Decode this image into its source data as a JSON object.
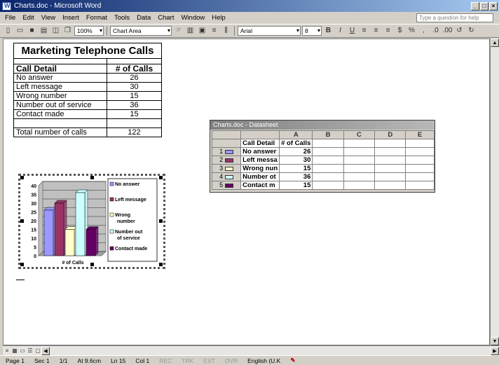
{
  "window": {
    "title": "Charts.doc - Microsoft Word"
  },
  "menu": [
    "File",
    "Edit",
    "View",
    "Insert",
    "Format",
    "Tools",
    "Data",
    "Chart",
    "Window",
    "Help"
  ],
  "help_placeholder": "Type a question for help",
  "toolbar": {
    "zoom": "100%",
    "chart_object": "Chart Area",
    "font": "Arial",
    "size": "8"
  },
  "word_table": {
    "title": "Marketing Telephone Calls",
    "col_headers": [
      "Call Detail",
      "# of Calls"
    ],
    "rows": [
      [
        "No answer",
        "26"
      ],
      [
        "Left message",
        "30"
      ],
      [
        "Wrong number",
        "15"
      ],
      [
        "Number out of service",
        "36"
      ],
      [
        "Contact made",
        "15"
      ]
    ],
    "total_label": "Total number of calls",
    "total_value": "122"
  },
  "chart_data": {
    "type": "bar",
    "categories": [
      "# of Calls"
    ],
    "series": [
      {
        "name": "No answer",
        "values": [
          26
        ],
        "color": "#9999ff"
      },
      {
        "name": "Left message",
        "values": [
          30
        ],
        "color": "#993366"
      },
      {
        "name": "Wrong number",
        "values": [
          15
        ],
        "color": "#ffffcc"
      },
      {
        "name": "Number out of service",
        "values": [
          36
        ],
        "color": "#ccffff"
      },
      {
        "name": "Contact made",
        "values": [
          15
        ],
        "color": "#660066"
      }
    ],
    "legend_labels": [
      "No answer",
      "Left message",
      "Wrong",
      "number",
      "Number out",
      "of service",
      "Contact made"
    ],
    "yticks": [
      "0",
      "5",
      "10",
      "15",
      "20",
      "25",
      "30",
      "35",
      "40"
    ],
    "ylim": [
      0,
      40
    ],
    "xlabel": "# of Calls",
    "legend": "right",
    "grid": true
  },
  "datasheet": {
    "title": "Charts.doc - Datasheet",
    "columns": [
      "A",
      "B",
      "C",
      "D",
      "E"
    ],
    "header_row": [
      "Call Detail",
      "# of Calls"
    ],
    "rows": [
      {
        "num": "1",
        "label": "No answer",
        "value": "26",
        "color": "#9999ff"
      },
      {
        "num": "2",
        "label": "Left messa",
        "value": "30",
        "color": "#993366"
      },
      {
        "num": "3",
        "label": "Wrong nun",
        "value": "15",
        "color": "#ffffcc"
      },
      {
        "num": "4",
        "label": "Number ot",
        "value": "36",
        "color": "#ccffff"
      },
      {
        "num": "5",
        "label": "Contact m",
        "value": "15",
        "color": "#660066"
      }
    ]
  },
  "status": {
    "page": "Page 1",
    "sec": "Sec 1",
    "pages": "1/1",
    "at": "At 9.6cm",
    "ln": "Ln 15",
    "col": "Col 1",
    "rec": "REC",
    "trk": "TRK",
    "ext": "EXT",
    "ovr": "OVR",
    "lang": "English (U.K"
  }
}
